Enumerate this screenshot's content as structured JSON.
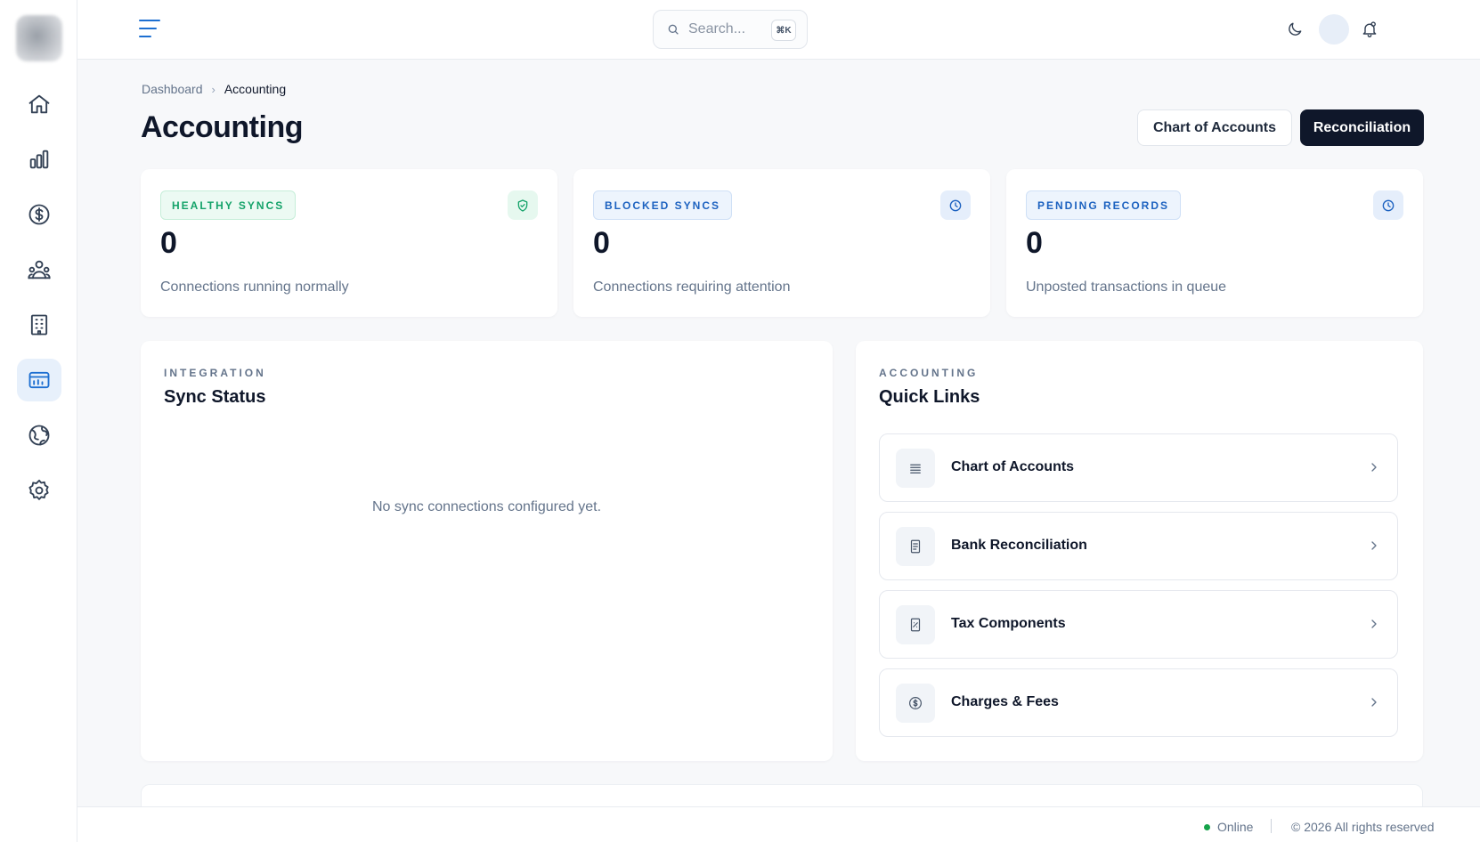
{
  "sidebar": {
    "items": [
      {
        "name": "home-icon"
      },
      {
        "name": "analytics-icon"
      },
      {
        "name": "dollar-icon"
      },
      {
        "name": "people-icon"
      },
      {
        "name": "building-icon"
      },
      {
        "name": "accounting-icon",
        "active": true
      },
      {
        "name": "globe-icon"
      },
      {
        "name": "settings-icon"
      }
    ]
  },
  "topbar": {
    "search_placeholder": "Search...",
    "search_shortcut": "⌘K"
  },
  "breadcrumb": {
    "parent": "Dashboard",
    "current": "Accounting"
  },
  "page": {
    "title": "Accounting",
    "buttons": {
      "chart_of_accounts": "Chart of Accounts",
      "reconciliation": "Reconciliation"
    }
  },
  "stats": [
    {
      "label": "HEALTHY SYNCS",
      "value": "0",
      "description": "Connections running normally",
      "accent": "#15a36a",
      "icon": "shield-check-icon"
    },
    {
      "label": "BLOCKED SYNCS",
      "value": "0",
      "description": "Connections requiring attention",
      "accent": "#1d62c0",
      "icon": "clock-icon"
    },
    {
      "label": "PENDING RECORDS",
      "value": "0",
      "description": "Unposted transactions in queue",
      "accent": "#1d62c0",
      "icon": "clock-icon"
    }
  ],
  "sync_panel": {
    "eyebrow": "INTEGRATION",
    "title": "Sync Status",
    "empty_message": "No sync connections configured yet."
  },
  "quick_links": {
    "eyebrow": "ACCOUNTING",
    "title": "Quick Links",
    "items": [
      {
        "label": "Chart of Accounts",
        "icon": "list-icon"
      },
      {
        "label": "Bank Reconciliation",
        "icon": "document-icon"
      },
      {
        "label": "Tax Components",
        "icon": "receipt-icon"
      },
      {
        "label": "Charges & Fees",
        "icon": "dollar-circle-icon"
      }
    ]
  },
  "footer": {
    "status": "Online",
    "status_color": "#16a34a",
    "copyright": "© 2026 All rights reserved"
  }
}
